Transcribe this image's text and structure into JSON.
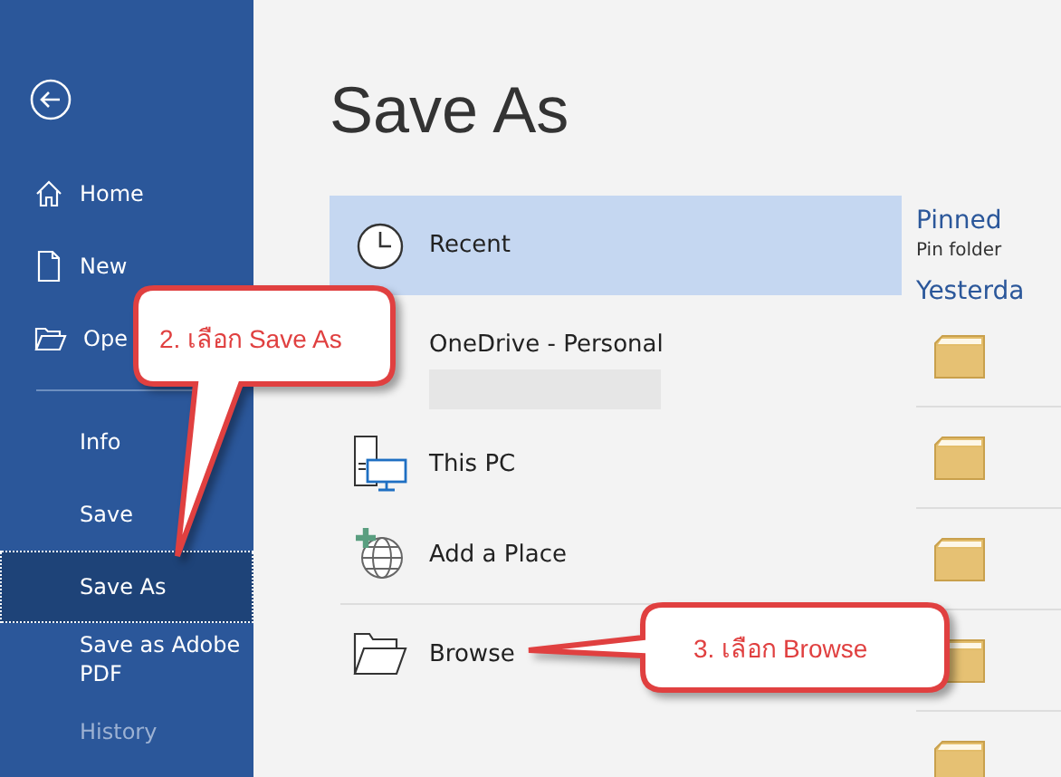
{
  "sidebar": {
    "top_items": [
      {
        "label": "Home"
      },
      {
        "label": "New"
      },
      {
        "label": "Ope"
      }
    ],
    "items": [
      {
        "label": "Info",
        "selected": false,
        "disabled": false
      },
      {
        "label": "Save",
        "selected": false,
        "disabled": false
      },
      {
        "label": "Save As",
        "selected": true,
        "disabled": false
      },
      {
        "label": "Save as Adobe PDF",
        "selected": false,
        "disabled": false
      },
      {
        "label": "History",
        "selected": false,
        "disabled": true
      }
    ]
  },
  "page_title": "Save As",
  "locations": [
    {
      "label": "Recent",
      "selected": true
    },
    {
      "label": "OneDrive - Personal",
      "selected": false
    },
    {
      "label": "This PC",
      "selected": false
    },
    {
      "label": "Add a Place",
      "selected": false
    },
    {
      "label": "Browse",
      "selected": false
    }
  ],
  "recent_panel": {
    "pinned_heading": "Pinned",
    "pinned_hint": "Pin folder",
    "group_heading": "Yesterda"
  },
  "callouts": [
    {
      "text": "2. เลือก Save As"
    },
    {
      "text": "3. เลือก Browse"
    }
  ]
}
